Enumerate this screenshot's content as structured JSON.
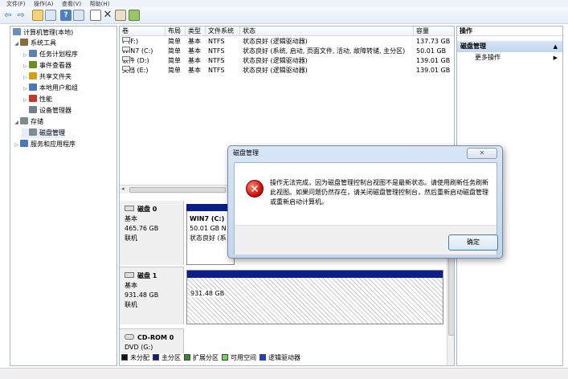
{
  "menubar": {
    "items": [
      "文件(F)",
      "操作(A)",
      "查看(V)",
      "帮助(H)"
    ]
  },
  "toolbar": {
    "buttons": [
      "back-icon",
      "forward-icon",
      "up-icon",
      "properties-icon",
      "help-icon",
      "console-icon",
      "connect-icon",
      "delete-icon",
      "properties-icon-2",
      "wizard-icon"
    ]
  },
  "tree": {
    "root": "计算机管理(本地)",
    "items": [
      {
        "label": "系统工具",
        "level": 1,
        "arrow": "◢",
        "color": "#8a6d3b"
      },
      {
        "label": "任务计划程序",
        "level": 2,
        "arrow": "▷",
        "color": "#5b7fb7"
      },
      {
        "label": "事件查看器",
        "level": 2,
        "arrow": "▷",
        "color": "#6b8e23"
      },
      {
        "label": "共享文件夹",
        "level": 2,
        "arrow": "▷",
        "color": "#d4a017"
      },
      {
        "label": "本地用户和组",
        "level": 2,
        "arrow": "▷",
        "color": "#4a7ab5"
      },
      {
        "label": "性能",
        "level": 2,
        "arrow": "▷",
        "color": "#c0392b"
      },
      {
        "label": "设备管理器",
        "level": 2,
        "arrow": "",
        "color": "#6f7f90"
      },
      {
        "label": "存储",
        "level": 1,
        "arrow": "◢",
        "color": "#7f8c8d"
      },
      {
        "label": "磁盘管理",
        "level": 2,
        "arrow": "",
        "color": "#7f8c8d"
      },
      {
        "label": "服务和应用程序",
        "level": 1,
        "arrow": "▷",
        "color": "#4a7ab5"
      }
    ]
  },
  "volumes": {
    "headers": [
      "卷",
      "布局",
      "类型",
      "文件系统",
      "状态",
      "容量"
    ],
    "rows": [
      [
        "F (F:)",
        "简单",
        "基本",
        "NTFS",
        "状态良好 (逻辑驱动器)",
        "137.73 GB"
      ],
      [
        "WIN7 (C:)",
        "简单",
        "基本",
        "NTFS",
        "状态良好 (系统, 启动, 页面文件, 活动, 故障转储, 主分区)",
        "50.01 GB"
      ],
      [
        "软件 (D:)",
        "简单",
        "基本",
        "NTFS",
        "状态良好 (逻辑驱动器)",
        "139.01 GB"
      ],
      [
        "文档 (E:)",
        "简单",
        "基本",
        "NTFS",
        "状态良好 (逻辑驱动器)",
        "139.01 GB"
      ]
    ]
  },
  "disks": [
    {
      "name": "磁盘 0",
      "type": "基本",
      "size": "465.76 GB",
      "status": "联机",
      "partition": {
        "name": "WIN7  (C:)",
        "size": "50.01 GB N",
        "status": "状态良好 (系"
      }
    },
    {
      "name": "磁盘 1",
      "type": "基本",
      "size": "931.48 GB",
      "status": "联机",
      "partition": {
        "size": "931.48 GB"
      }
    },
    {
      "name": "CD-ROM 0",
      "type": "DVD (G:)"
    }
  ],
  "legend": [
    {
      "label": "未分配",
      "color": "#111111"
    },
    {
      "label": "主分区",
      "color": "#0b1e8a"
    },
    {
      "label": "扩展分区",
      "color": "#2e8b2e"
    },
    {
      "label": "可用空间",
      "color": "#66dd55"
    },
    {
      "label": "逻辑驱动器",
      "color": "#1a3fd8"
    }
  ],
  "actions": {
    "header": "操作",
    "section": "磁盘管理",
    "more": "更多操作"
  },
  "dialog": {
    "title": "磁盘管理",
    "message": "操作无法完成，因为磁盘管理控制台视图不是最新状态。请使用刷新任务刷新此视图。如果问题仍然存在，请关闭磁盘管理控制台，然后重新启动磁盘管理或重新启动计算机。",
    "ok": "确定",
    "close": "✕"
  }
}
